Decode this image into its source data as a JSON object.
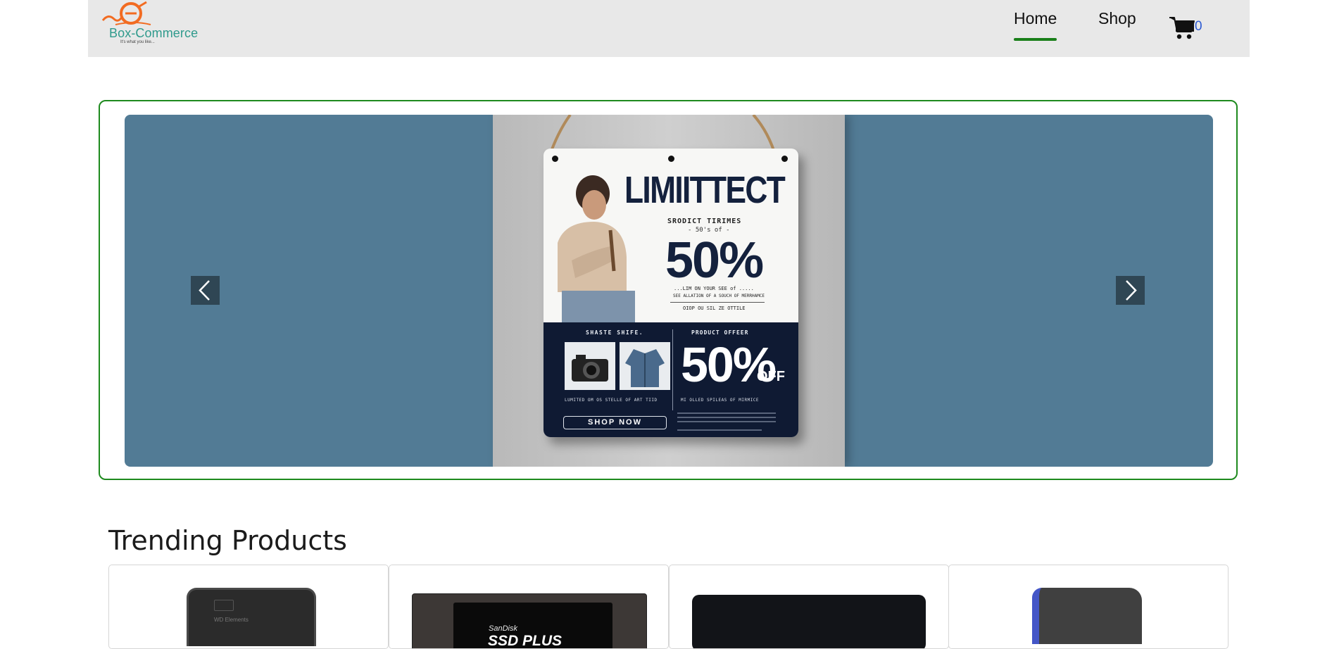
{
  "header": {
    "logo": {
      "name": "Box-Commerce",
      "tagline": "It's what you like...",
      "accent_color": "#f26b21",
      "text_color": "#2f9a8c"
    },
    "nav": [
      {
        "label": "Home",
        "active": true
      },
      {
        "label": "Shop",
        "active": false
      }
    ],
    "cart": {
      "icon": "shopping-cart-icon",
      "count": "0"
    },
    "active_color": "#1a7f1a"
  },
  "carousel": {
    "border_color": "#1e8a1e",
    "background_color": "#527b95",
    "prev_icon": "chevron-left-icon",
    "next_icon": "chevron-right-icon",
    "slide": {
      "headline": "LIMIITTECT",
      "subheading": "SRODICT TIRIMES",
      "subheading2": "- 50's of -",
      "big_percent": "50%",
      "line1": "...LIM ON YOUR SEE of .....",
      "line2": "SEE ALLATION OF A SOUCH OF MERRHAMCE",
      "line3": "OIOP OU SIL ZE OTTILE",
      "panel_left_title": "SHASTE SHIFE.",
      "panel_right_title": "PRODUCT OFFEER",
      "panel_percent": "50%",
      "panel_off": "OFF",
      "panel_left_foot": "LUMITED OM OS STELLE OF ART TIID",
      "panel_right_foot": "MI OLLED SPILEAS OF MIRMICE",
      "cta": "SHOP NOW"
    }
  },
  "trending": {
    "title": "Trending Products",
    "products": [
      {
        "image": "wd-elements-external-drive",
        "brand_text": "WD Elements"
      },
      {
        "image": "sandisk-ssd-plus",
        "brand_text": "SanDisk",
        "line_text": "SSD PLUS"
      },
      {
        "image": "black-patterned-external-drive"
      },
      {
        "image": "wd-black-gaming-drive"
      }
    ]
  }
}
